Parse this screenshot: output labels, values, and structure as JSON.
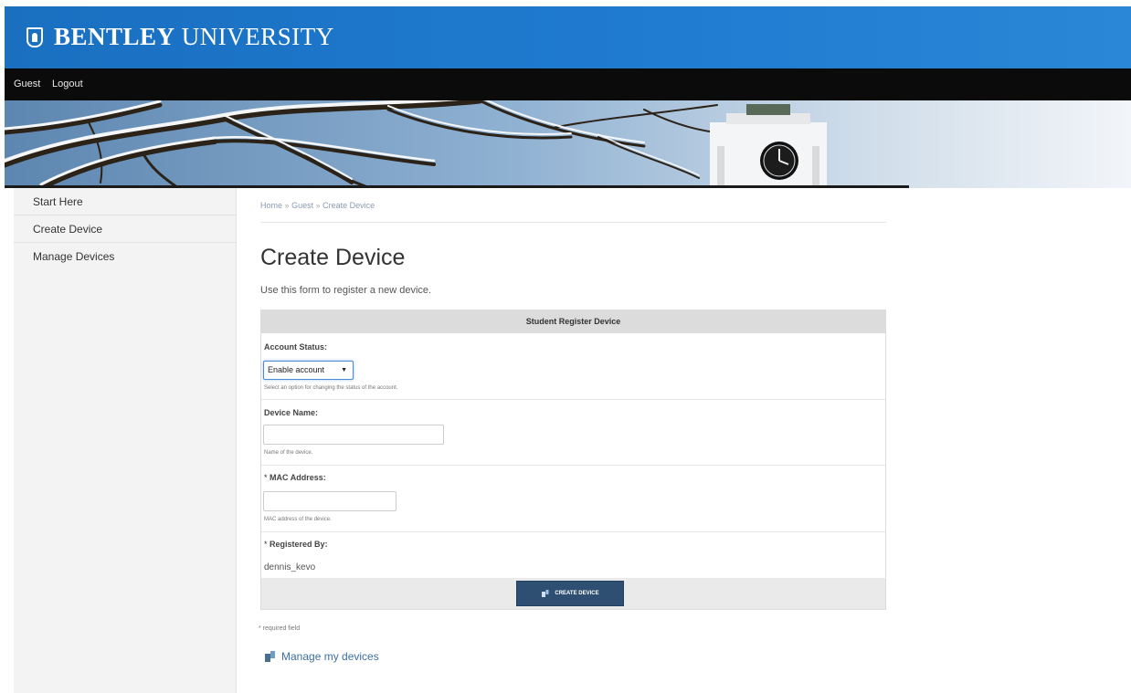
{
  "brand": {
    "bold": "BENTLEY",
    "light": " UNIVERSITY",
    "logo_icon": "shield-logo-icon",
    "color": "#1f78c9"
  },
  "user_bar": {
    "guest": "Guest",
    "logout": "Logout"
  },
  "sidebar": {
    "items": [
      {
        "label": "Start Here"
      },
      {
        "label": "Create Device"
      },
      {
        "label": "Manage Devices"
      }
    ]
  },
  "breadcrumb": {
    "home": "Home",
    "sep": "»",
    "guest": "Guest",
    "current": "Create Device"
  },
  "page": {
    "title": "Create Device",
    "description": "Use this form to register a new device."
  },
  "form": {
    "header": "Student Register Device",
    "account_status": {
      "label": "Account Status:",
      "value": "Enable account",
      "help": "Select an option for changing the status of the account."
    },
    "device_name": {
      "label": "Device Name:",
      "value": "",
      "help": "Name of the device."
    },
    "mac_address": {
      "label": "MAC Address:",
      "value": "",
      "help": "MAC address of the device."
    },
    "registered_by": {
      "label": "Registered By:",
      "value": "dennis_kevo"
    },
    "required_star": "*",
    "submit_label": "CREATE DEVICE"
  },
  "footer": {
    "required_note": "* required field",
    "manage_link": "Manage my devices"
  },
  "colors": {
    "brand_blue": "#1f78c9",
    "user_bar": "#0b0b0b",
    "button": "#2f4f72",
    "link": "#3d6fa6"
  }
}
